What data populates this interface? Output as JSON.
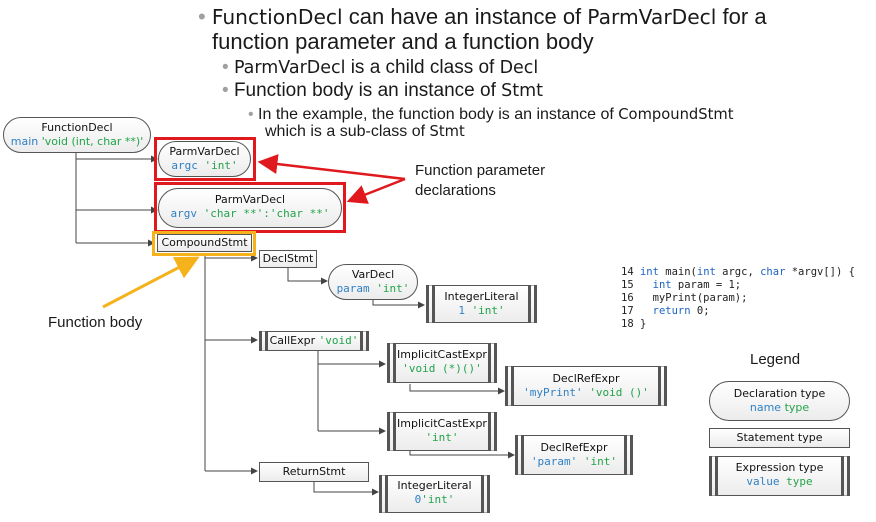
{
  "bullets": [
    {
      "level": 1,
      "parts": [
        {
          "text": "FunctionDecl",
          "style": "class"
        },
        {
          "text": " can have an instance of ",
          "style": "plain"
        },
        {
          "text": "ParmVarDecl",
          "style": "class"
        },
        {
          "text": " for a",
          "style": "plain"
        }
      ]
    },
    {
      "level": 1,
      "continuation": true,
      "parts": [
        {
          "text": "function parameter and a function body",
          "style": "plain"
        }
      ]
    },
    {
      "level": 2,
      "parts": [
        {
          "text": "ParmVarDecl",
          "style": "class"
        },
        {
          "text": " is a child class of ",
          "style": "plain"
        },
        {
          "text": "Decl",
          "style": "class"
        }
      ]
    },
    {
      "level": 2,
      "parts": [
        {
          "text": "Function body is an instance of ",
          "style": "plain"
        },
        {
          "text": "Stmt",
          "style": "class"
        }
      ]
    },
    {
      "level": 3,
      "parts": [
        {
          "text": "In the example, the function body is an instance of ",
          "style": "plain"
        },
        {
          "text": "CompoundStmt",
          "style": "class"
        }
      ]
    },
    {
      "level": 3,
      "continuation": true,
      "parts": [
        {
          "text": "which is a sub-class of ",
          "style": "plain"
        },
        {
          "text": "Stmt",
          "style": "class"
        }
      ]
    }
  ],
  "nodes": {
    "function_decl": {
      "kind": "FunctionDecl",
      "name": "main",
      "type": "'void (int, char **)'"
    },
    "parm_argc": {
      "kind": "ParmVarDecl",
      "name": "argc",
      "type": "'int'"
    },
    "parm_argv": {
      "kind": "ParmVarDecl",
      "name": "argv",
      "type": "'char **':'char **'"
    },
    "compound_stmt": {
      "kind": "CompoundStmt"
    },
    "decl_stmt": {
      "kind": "DeclStmt"
    },
    "var_decl": {
      "kind": "VarDecl",
      "name": "param",
      "type": "'int'"
    },
    "integer_literal_1": {
      "kind": "IntegerLiteral",
      "value": "1",
      "type": "'int'"
    },
    "call_expr": {
      "kind": "CallExpr",
      "type": "'void'"
    },
    "implicit_cast_1": {
      "kind": "ImplicitCastExpr",
      "type": "'void (*)()'"
    },
    "decl_ref_1": {
      "kind": "DeclRefExpr",
      "value": "'myPrint'",
      "type": "'void ()'"
    },
    "implicit_cast_2": {
      "kind": "ImplicitCastExpr",
      "type": "'int'"
    },
    "decl_ref_2": {
      "kind": "DeclRefExpr",
      "value": "'param'",
      "type": "'int'"
    },
    "return_stmt": {
      "kind": "ReturnStmt"
    },
    "integer_literal_0": {
      "kind": "IntegerLiteral",
      "value": "0",
      "type": "'int'"
    }
  },
  "annotations": {
    "param_decls_line1": "Function parameter",
    "param_decls_line2": "declarations",
    "function_body": "Function body"
  },
  "code": [
    {
      "line": "14",
      "tokens": [
        {
          "t": "int",
          "kw": true
        },
        {
          "t": " main(",
          "kw": false
        },
        {
          "t": "int",
          "kw": true
        },
        {
          "t": " argc, ",
          "kw": false
        },
        {
          "t": "char",
          "kw": true
        },
        {
          "t": " *argv[]) {",
          "kw": false
        }
      ]
    },
    {
      "line": "15",
      "tokens": [
        {
          "t": "  ",
          "kw": false
        },
        {
          "t": "int",
          "kw": true
        },
        {
          "t": " param = 1;",
          "kw": false
        }
      ]
    },
    {
      "line": "16",
      "tokens": [
        {
          "t": "  myPrint(param);",
          "kw": false
        }
      ]
    },
    {
      "line": "17",
      "tokens": [
        {
          "t": "  ",
          "kw": false
        },
        {
          "t": "return",
          "kw": true
        },
        {
          "t": " 0;",
          "kw": false
        }
      ]
    },
    {
      "line": "18",
      "tokens": [
        {
          "t": "}",
          "kw": false
        }
      ]
    }
  ],
  "legend": {
    "title": "Legend",
    "declaration": {
      "label": "Declaration type",
      "name": "name",
      "type": "type"
    },
    "statement": {
      "label": "Statement type"
    },
    "expression": {
      "label": "Expression type",
      "value": "value",
      "type": "type"
    }
  },
  "colors": {
    "name_blue": "#2f80c4",
    "type_green": "#22a34a",
    "highlight_red": "#e0191e",
    "highlight_orange": "#f5b21b"
  }
}
